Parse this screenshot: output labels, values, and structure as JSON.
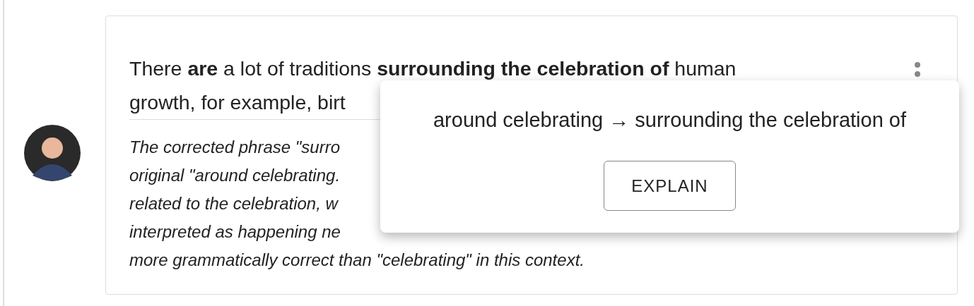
{
  "sentence": {
    "line_1": "There **are** a lot of traditions **surrounding the celebration of** human",
    "line_2": "growth, for example, birt"
  },
  "explanation_lines": [
    "The corrected phrase \"surro",
    "original \"around celebrating.",
    "related to the celebration, w",
    "interpreted as happening ne",
    "more grammatically correct than \"celebrating\" in this context."
  ],
  "suggestion_popup": {
    "text": "around celebrating → surrounding the celebration of",
    "button": "EXPLAIN"
  }
}
